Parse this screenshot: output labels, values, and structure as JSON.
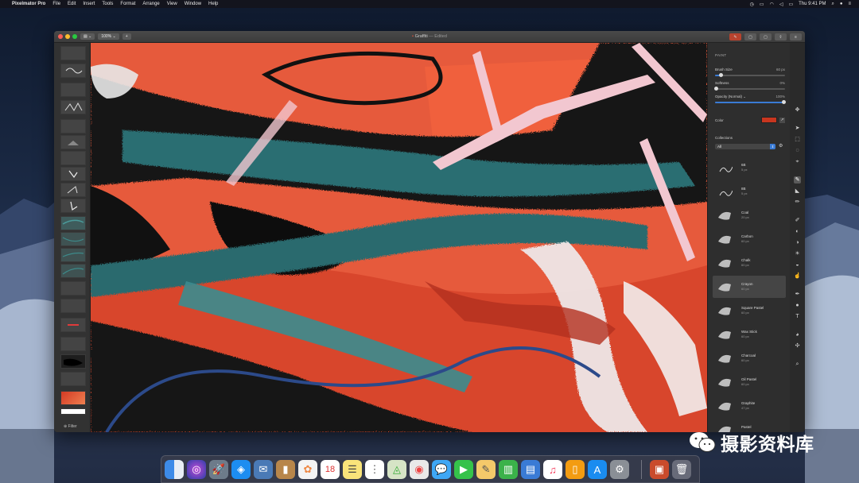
{
  "menubar": {
    "apple": "",
    "app_name": "Pixelmator Pro",
    "items": [
      "File",
      "Edit",
      "Insert",
      "Tools",
      "Format",
      "Arrange",
      "View",
      "Window",
      "Help"
    ],
    "clock": "Thu 9:41 PM"
  },
  "window": {
    "zoom": "100%",
    "add": "+",
    "title": "Graffiti",
    "title_suffix": "— Edited"
  },
  "layers": {
    "filter_label": "Filter"
  },
  "panel": {
    "section": "PAINT",
    "brush_size_label": "Brush Size",
    "brush_size_value": "60 px",
    "brush_size_level": 0.08,
    "softness_label": "Softness",
    "softness_value": "0%",
    "softness_level": 0.0,
    "opacity_label": "Opacity (Normal) ⌄",
    "opacity_value": "100%",
    "opacity_level": 1.0,
    "color_label": "Color",
    "color_value": "#c8361f",
    "collections_label": "Collections",
    "collection_selected": "All",
    "brushes": [
      {
        "name": "6B",
        "size": "5 px"
      },
      {
        "name": "8B",
        "size": "5 px"
      },
      {
        "name": "Coal",
        "size": "20 px"
      },
      {
        "name": "Carbon",
        "size": "60 px"
      },
      {
        "name": "Chalk",
        "size": "60 px"
      },
      {
        "name": "Crayon",
        "size": "60 px"
      },
      {
        "name": "Square Pastel",
        "size": "60 px"
      },
      {
        "name": "Wax Stick",
        "size": "60 px"
      },
      {
        "name": "Charcoal",
        "size": "60 px"
      },
      {
        "name": "Oil Pastel",
        "size": "60 px"
      },
      {
        "name": "Graphite",
        "size": "47 px"
      },
      {
        "name": "Pastel",
        "size": ""
      }
    ],
    "selected_brush": "Crayon"
  },
  "watermark": {
    "text": "摄影资料库"
  },
  "colors": {
    "accent": "#3a7bd5",
    "canvas_orange": "#e85a3a",
    "teal": "#2b6b6e"
  }
}
